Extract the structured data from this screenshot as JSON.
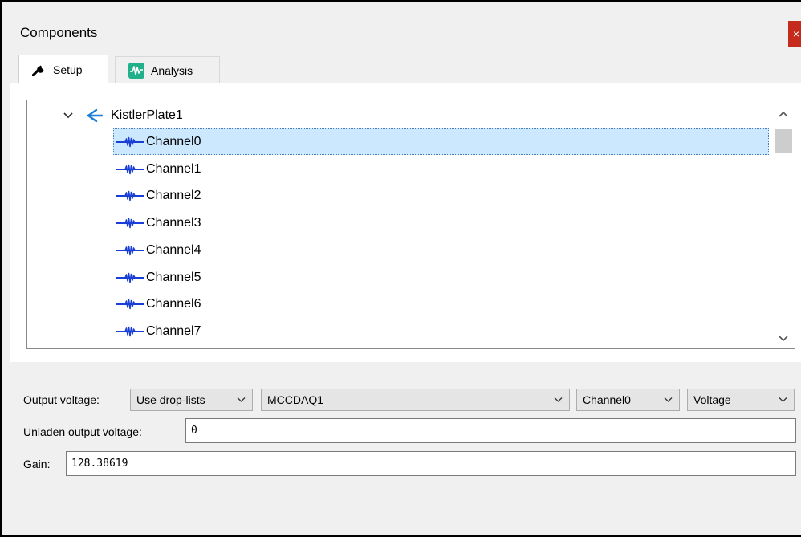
{
  "window": {
    "title": "Components",
    "close_label": "×"
  },
  "tabs": [
    {
      "label": "Setup",
      "icon": "wrench-icon",
      "active": true
    },
    {
      "label": "Analysis",
      "icon": "waveform-icon",
      "active": false
    }
  ],
  "tree": {
    "root": {
      "label": "KistlerPlate1",
      "icon": "kistler-plate-icon",
      "expanded": true
    },
    "items": [
      {
        "label": "Channel0",
        "selected": true
      },
      {
        "label": "Channel1",
        "selected": false
      },
      {
        "label": "Channel2",
        "selected": false
      },
      {
        "label": "Channel3",
        "selected": false
      },
      {
        "label": "Channel4",
        "selected": false
      },
      {
        "label": "Channel5",
        "selected": false
      },
      {
        "label": "Channel6",
        "selected": false
      },
      {
        "label": "Channel7",
        "selected": false
      }
    ]
  },
  "props": {
    "output_voltage_label": "Output voltage:",
    "mode_value": "Use drop-lists",
    "device_value": "MCCDAQ1",
    "channel_value": "Channel0",
    "type_value": "Voltage",
    "unladen_label": "Unladen output voltage:",
    "unladen_value": "0",
    "gain_label": "Gain:",
    "gain_value": "128.38619"
  },
  "colors": {
    "selection": "#cce8ff",
    "close": "#c42b1c",
    "signal_icon": "#1a3fd6",
    "kistler_icon": "#1a7fd6"
  }
}
